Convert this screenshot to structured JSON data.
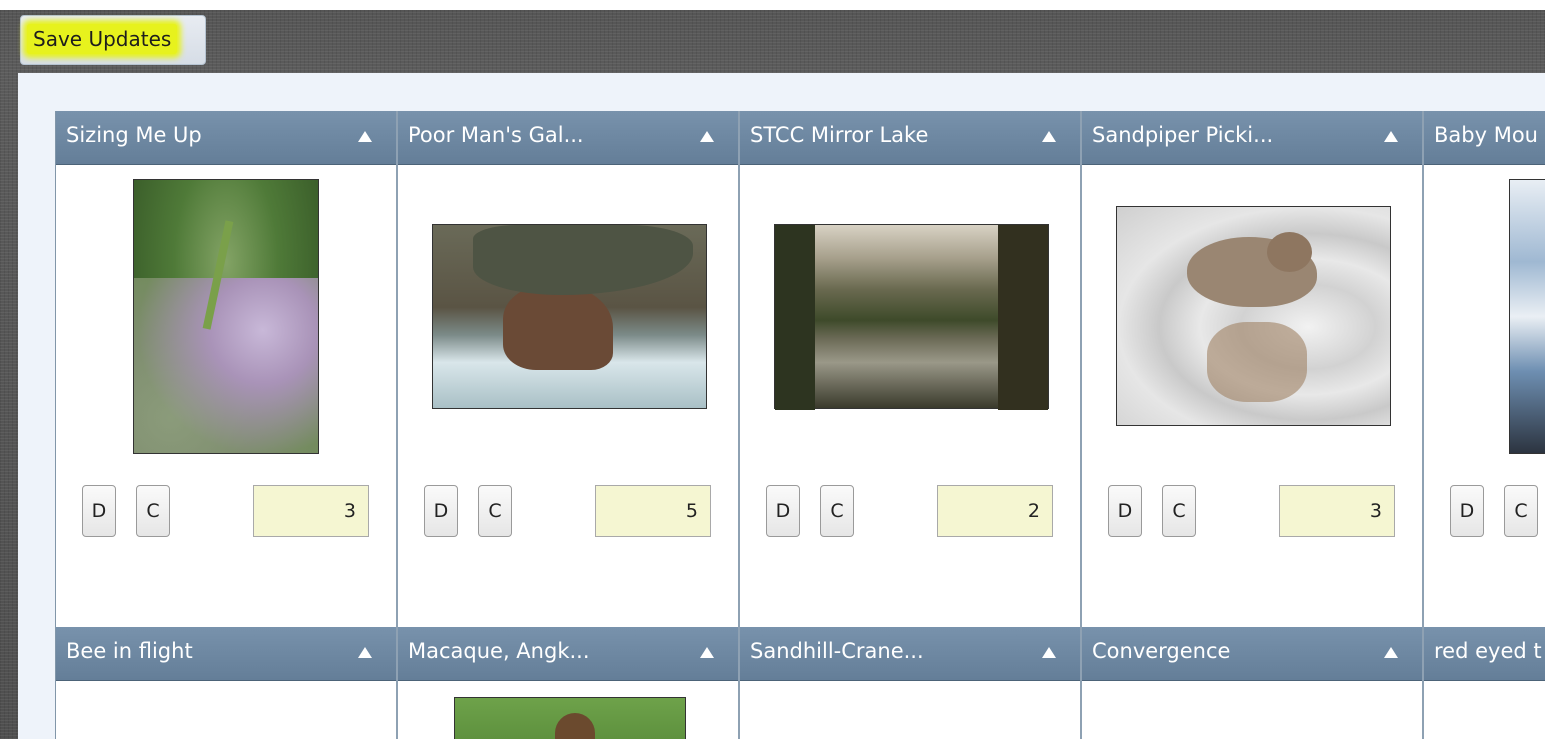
{
  "toolbar": {
    "save_label": "Save Updates"
  },
  "cards_row1": [
    {
      "title": "Sizing Me Up",
      "vote": "3",
      "delete_label": "D",
      "comment_label": "C"
    },
    {
      "title": "Poor Man's Gal...",
      "vote": "5",
      "delete_label": "D",
      "comment_label": "C"
    },
    {
      "title": "STCC Mirror Lake",
      "vote": "2",
      "delete_label": "D",
      "comment_label": "C"
    },
    {
      "title": "Sandpiper Picki...",
      "vote": "3",
      "delete_label": "D",
      "comment_label": "C"
    },
    {
      "title": "Baby Mou",
      "delete_label": "D",
      "comment_label": "C"
    }
  ],
  "cards_row2": [
    {
      "title": "Bee in flight"
    },
    {
      "title": "Macaque, Angk..."
    },
    {
      "title": "Sandhill-Crane..."
    },
    {
      "title": "Convergence"
    },
    {
      "title": "red eyed t"
    }
  ],
  "icons": {
    "sort": "sort-up-triangle-icon"
  },
  "colors": {
    "header": "#6d87a1",
    "highlight": "#e7f21d",
    "vote_bg": "#f5f6d2"
  }
}
